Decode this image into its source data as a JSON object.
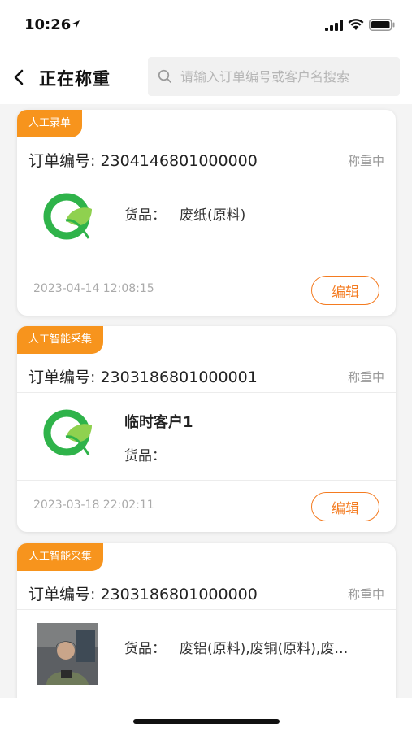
{
  "status_bar": {
    "time": "10:26",
    "icons": [
      "location-arrow-icon",
      "signal-icon",
      "wifi-icon",
      "battery-icon"
    ]
  },
  "nav": {
    "back_icon": "chevron-left-icon",
    "title": "正在称重",
    "search_placeholder": "请输入订单编号或客户名搜索",
    "search_value": ""
  },
  "colors": {
    "accent": "#f7941d",
    "edit_border": "#f47b20",
    "logo_green": "#2fb34a"
  },
  "orders": [
    {
      "tag": "人工录单",
      "order_label": "订单编号: 2304146801000000",
      "status": "称重中",
      "customer": "",
      "goods_label": "货品：",
      "goods_value": "废纸(原料)",
      "image": "leaf-logo-icon",
      "date": "2023-04-14 12:08:15",
      "edit_label": "编辑"
    },
    {
      "tag": "人工智能采集",
      "order_label": "订单编号: 2303186801000001",
      "status": "称重中",
      "customer": "临时客户1",
      "goods_label": "货品：",
      "goods_value": "",
      "image": "leaf-logo-icon",
      "date": "2023-03-18 22:02:11",
      "edit_label": "编辑"
    },
    {
      "tag": "人工智能采集",
      "order_label": "订单编号: 2303186801000000",
      "status": "称重中",
      "customer": "",
      "goods_label": "货品：",
      "goods_value": "废铝(原料),废铜(原料),废…",
      "image": "customer-photo",
      "date": "",
      "edit_label": ""
    }
  ]
}
